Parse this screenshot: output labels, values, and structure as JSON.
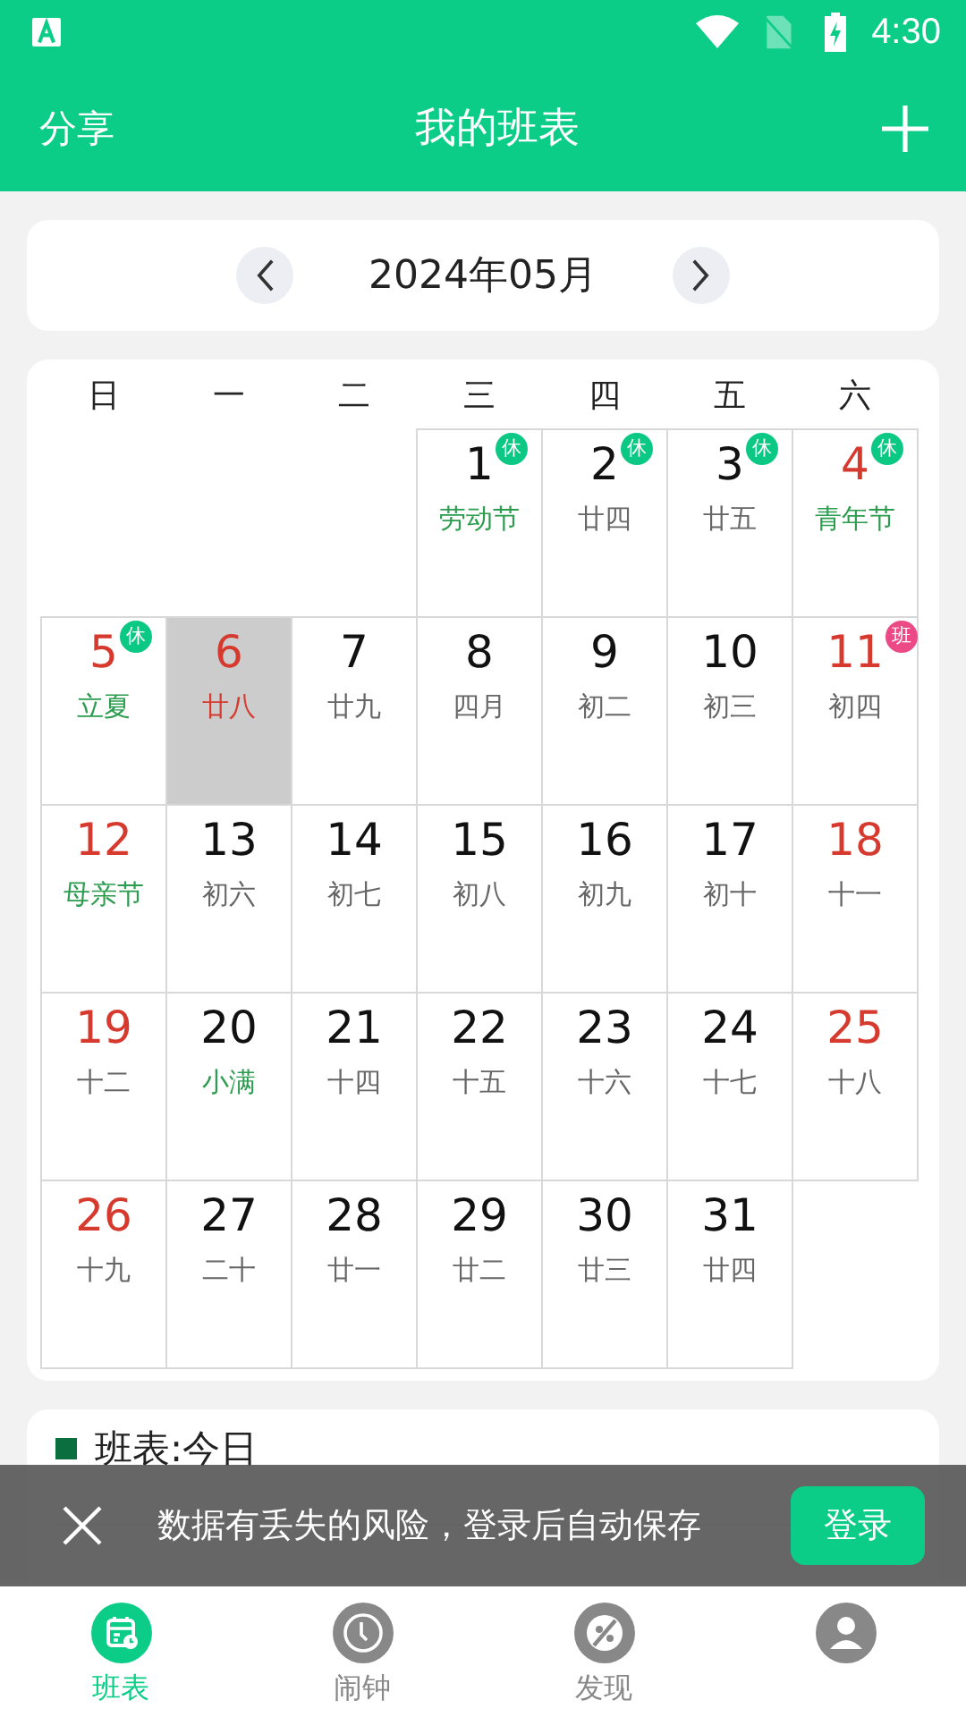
{
  "status_bar": {
    "time": "4:30"
  },
  "header": {
    "left": "分享",
    "title": "我的班表"
  },
  "month_nav": {
    "label": "2024年05月"
  },
  "weekdays": [
    "日",
    "一",
    "二",
    "三",
    "四",
    "五",
    "六"
  ],
  "days": [
    {
      "kind": "empty"
    },
    {
      "kind": "empty"
    },
    {
      "kind": "empty"
    },
    {
      "day": "1",
      "lunar": "劳动节",
      "festival": true,
      "weekend": false,
      "selected": false,
      "badge": "休",
      "color": "#0bc985"
    },
    {
      "day": "2",
      "lunar": "廿四",
      "festival": false,
      "weekend": false,
      "selected": false,
      "badge": "休",
      "color": "#0bc985"
    },
    {
      "day": "3",
      "lunar": "廿五",
      "festival": false,
      "weekend": false,
      "selected": false,
      "badge": "休",
      "color": "#0bc985"
    },
    {
      "day": "4",
      "lunar": "青年节",
      "festival": true,
      "weekend": true,
      "selected": false,
      "badge": "休",
      "color": "#0bc985"
    },
    {
      "day": "5",
      "lunar": "立夏",
      "festival": true,
      "weekend": true,
      "selected": false,
      "badge": "休",
      "color": "#0bc985"
    },
    {
      "day": "6",
      "lunar": "廿八",
      "festival": false,
      "weekend": false,
      "selected": true
    },
    {
      "day": "7",
      "lunar": "廿九",
      "festival": false,
      "weekend": false,
      "selected": false
    },
    {
      "day": "8",
      "lunar": "四月",
      "festival": false,
      "weekend": false,
      "selected": false
    },
    {
      "day": "9",
      "lunar": "初二",
      "festival": false,
      "weekend": false,
      "selected": false
    },
    {
      "day": "10",
      "lunar": "初三",
      "festival": false,
      "weekend": false,
      "selected": false
    },
    {
      "day": "11",
      "lunar": "初四",
      "festival": false,
      "weekend": true,
      "selected": false,
      "badge": "班",
      "color": "#ec4a86"
    },
    {
      "day": "12",
      "lunar": "母亲节",
      "festival": true,
      "weekend": true,
      "selected": false
    },
    {
      "day": "13",
      "lunar": "初六",
      "festival": false,
      "weekend": false,
      "selected": false
    },
    {
      "day": "14",
      "lunar": "初七",
      "festival": false,
      "weekend": false,
      "selected": false
    },
    {
      "day": "15",
      "lunar": "初八",
      "festival": false,
      "weekend": false,
      "selected": false
    },
    {
      "day": "16",
      "lunar": "初九",
      "festival": false,
      "weekend": false,
      "selected": false
    },
    {
      "day": "17",
      "lunar": "初十",
      "festival": false,
      "weekend": false,
      "selected": false
    },
    {
      "day": "18",
      "lunar": "十一",
      "festival": false,
      "weekend": true,
      "selected": false
    },
    {
      "day": "19",
      "lunar": "十二",
      "festival": false,
      "weekend": true,
      "selected": false
    },
    {
      "day": "20",
      "lunar": "小满",
      "festival": true,
      "weekend": false,
      "selected": false
    },
    {
      "day": "21",
      "lunar": "十四",
      "festival": false,
      "weekend": false,
      "selected": false
    },
    {
      "day": "22",
      "lunar": "十五",
      "festival": false,
      "weekend": false,
      "selected": false
    },
    {
      "day": "23",
      "lunar": "十六",
      "festival": false,
      "weekend": false,
      "selected": false
    },
    {
      "day": "24",
      "lunar": "十七",
      "festival": false,
      "weekend": false,
      "selected": false
    },
    {
      "day": "25",
      "lunar": "十八",
      "festival": false,
      "weekend": true,
      "selected": false
    },
    {
      "day": "26",
      "lunar": "十九",
      "festival": false,
      "weekend": true,
      "selected": false
    },
    {
      "day": "27",
      "lunar": "二十",
      "festival": false,
      "weekend": false,
      "selected": false
    },
    {
      "day": "28",
      "lunar": "廿一",
      "festival": false,
      "weekend": false,
      "selected": false
    },
    {
      "day": "29",
      "lunar": "廿二",
      "festival": false,
      "weekend": false,
      "selected": false
    },
    {
      "day": "30",
      "lunar": "廿三",
      "festival": false,
      "weekend": false,
      "selected": false
    },
    {
      "day": "31",
      "lunar": "廿四",
      "festival": false,
      "weekend": false,
      "selected": false
    }
  ],
  "today_panel": {
    "heading": "班表:今日"
  },
  "toast": {
    "message": "数据有丢失的风险，登录后自动保存",
    "button": "登录"
  },
  "tabs": [
    {
      "label": "班表",
      "selected": true,
      "kind": "calendar"
    },
    {
      "label": "闹钟",
      "selected": false,
      "kind": "clock"
    },
    {
      "label": "发现",
      "selected": false,
      "kind": "discover"
    },
    {
      "selected": false,
      "kind": "person"
    }
  ]
}
